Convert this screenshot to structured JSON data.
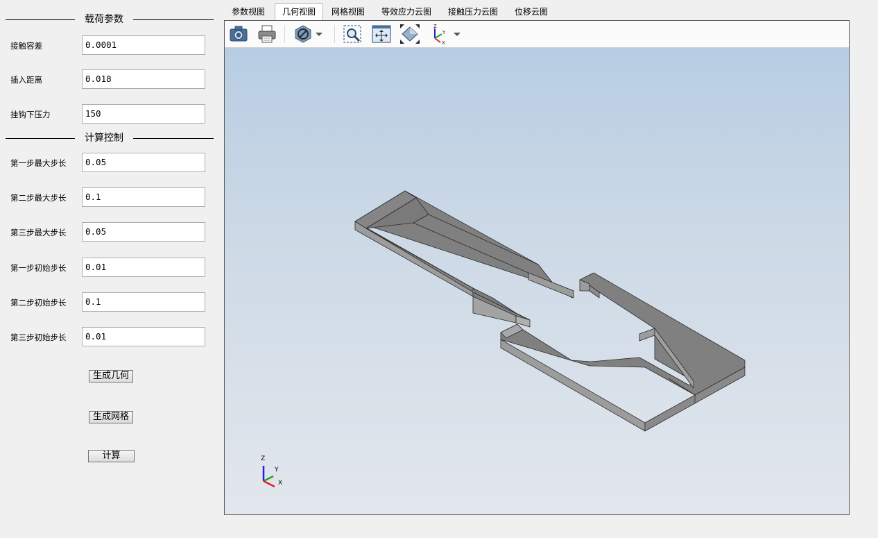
{
  "left_panel": {
    "load_group": {
      "title": "载荷参数",
      "fields": [
        {
          "label": "接触容差",
          "value": "0.0001"
        },
        {
          "label": "插入距离",
          "value": "0.018"
        },
        {
          "label": "挂钩下压力",
          "value": "150"
        }
      ]
    },
    "calc_group": {
      "title": "计算控制",
      "fields": [
        {
          "label": "第一步最大步长",
          "value": "0.05"
        },
        {
          "label": "第二步最大步长",
          "value": "0.1"
        },
        {
          "label": "第三步最大步长",
          "value": "0.05"
        },
        {
          "label": "第一步初始步长",
          "value": "0.01"
        },
        {
          "label": "第二步初始步长",
          "value": "0.1"
        },
        {
          "label": "第三步初始步长",
          "value": "0.01"
        }
      ]
    },
    "buttons": {
      "generate_geometry": "生成几何",
      "generate_mesh": "生成网格",
      "compute": "计算"
    }
  },
  "tabs": [
    "参数视图",
    "几何视图",
    "网格视图",
    "等效应力云图",
    "接触压力云图",
    "位移云图"
  ],
  "active_tab": "几何视图",
  "toolbar": {
    "icons": [
      "camera-icon",
      "printer-icon",
      "section-view-icon",
      "zoom-window-icon",
      "fit-all-icon",
      "reset-view-icon",
      "axes-orientation-icon"
    ]
  },
  "triad": {
    "x": "X",
    "y": "Y",
    "z": "Z"
  },
  "colors": {
    "model_top": "#808080",
    "model_side": "#9c9c9c",
    "model_edge": "#2a2a2a",
    "axis_x": "#e02020",
    "axis_y": "#20a020",
    "axis_z": "#2020e0"
  }
}
